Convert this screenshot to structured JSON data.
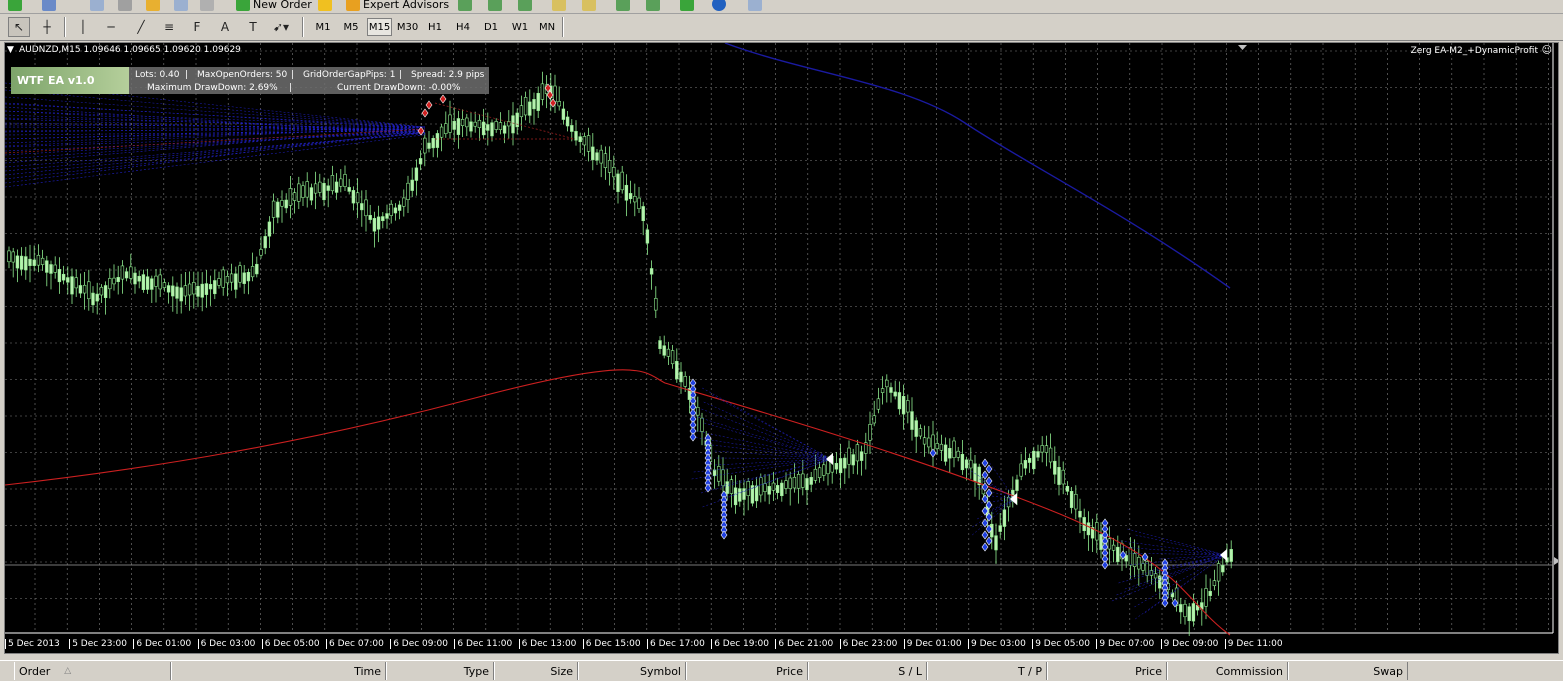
{
  "toolbar": {
    "new_order": "New Order",
    "expert_advisors": "Expert Advisors"
  },
  "timeframes": [
    "M1",
    "M5",
    "M15",
    "M30",
    "H1",
    "H4",
    "D1",
    "W1",
    "MN"
  ],
  "active_timeframe": "M15",
  "chart": {
    "symbol_info": "AUDNZD,M15  1.09646 1.09665 1.09620 1.09629",
    "ea_name": "Zerg EA-M2_+DynamicProfit",
    "x_labels": [
      "5 Dec 2013",
      "5 Dec 23:00",
      "6 Dec 01:00",
      "6 Dec 03:00",
      "6 Dec 05:00",
      "6 Dec 07:00",
      "6 Dec 09:00",
      "6 Dec 11:00",
      "6 Dec 13:00",
      "6 Dec 15:00",
      "6 Dec 17:00",
      "6 Dec 19:00",
      "6 Dec 21:00",
      "6 Dec 23:00",
      "9 Dec 01:00",
      "9 Dec 03:00",
      "9 Dec 05:00",
      "9 Dec 07:00",
      "9 Dec 09:00",
      "9 Dec 11:00"
    ],
    "colors": {
      "background": "#000000",
      "grid": "#808080",
      "candle": "#90ee90",
      "ma_red": "#cc2020",
      "ma_blue": "#1a1aa0"
    }
  },
  "ea_panel": {
    "title": "WTF EA v1.0",
    "lots": "Lots: 0.40",
    "max_open_orders": "MaxOpenOrders: 50",
    "grid_gap": "GridOrderGapPips: 1",
    "spread": "Spread: 2.9 pips",
    "max_drawdown": "Maximum DrawDown: 2.69%",
    "current_drawdown": "Current DrawDown: -0.00%"
  },
  "orders_table": {
    "columns": [
      "Order",
      "Time",
      "Type",
      "Size",
      "Symbol",
      "Price",
      "S / L",
      "T / P",
      "Price",
      "Commission",
      "Swap"
    ]
  }
}
